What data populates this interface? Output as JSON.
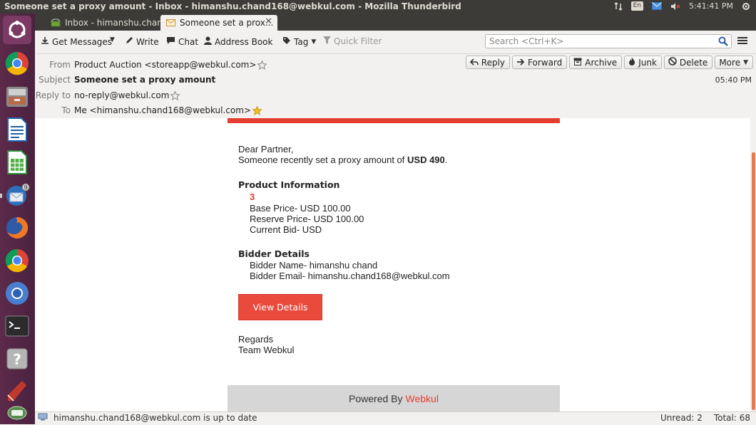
{
  "system_bar": {
    "window_title": "Someone set a proxy amount - Inbox - himanshu.chand168@webkul.com - Mozilla Thunderbird",
    "keyboard_layout": "En",
    "clock": "5:41:41 PM"
  },
  "launcher": {
    "items": [
      "ubuntu-dash-icon",
      "chrome-icon",
      "files-icon",
      "writer-icon",
      "calc-icon",
      "thunderbird-icon",
      "firefox-icon",
      "chrome-icon",
      "chromium-icon",
      "terminal-icon",
      "help-icon",
      "pencil-icon",
      "trash-icon"
    ],
    "thunderbird_badge": "9"
  },
  "tabs": [
    {
      "label": "Inbox - himanshu.chan...",
      "active": false
    },
    {
      "label": "Someone set a prox...",
      "active": true
    }
  ],
  "toolbar": {
    "get_messages": "Get Messages",
    "write": "Write",
    "chat": "Chat",
    "address_book": "Address Book",
    "tag": "Tag",
    "quick_filter": "Quick Filter",
    "search_placeholder": "Search <Ctrl+K>"
  },
  "header": {
    "from_label": "From",
    "from_value": "Product Auction <storeapp@webkul.com>",
    "subject_label": "Subject",
    "subject_value": "Someone set a proxy amount",
    "reply_to_label": "Reply to",
    "reply_to_value": "no-reply@webkul.com",
    "to_label": "To",
    "to_value": "Me <himanshu.chand168@webkul.com>",
    "time": "05:40 PM",
    "buttons": {
      "reply": "Reply",
      "forward": "Forward",
      "archive": "Archive",
      "junk": "Junk",
      "delete": "Delete",
      "more": "More"
    }
  },
  "email": {
    "greeting": "Dear Partner,",
    "intro_prefix": "Someone recently set a proxy amount of ",
    "intro_amount": "USD 490",
    "intro_suffix": ".",
    "product_heading": "Product Information",
    "product_name": "3",
    "base_price": "Base Price- USD 100.00",
    "reserve_price": "Reserve Price- USD 100.00",
    "current_bid": "Current Bid- USD",
    "bidder_heading": "Bidder Details",
    "bidder_name": "Bidder Name- himanshu chand",
    "bidder_email": "Bidder Email- himanshu.chand168@webkul.com",
    "view_button": "View Details",
    "regards": "Regards",
    "team": "Team Webkul",
    "powered_by": "Powered By",
    "brand": "Webkul"
  },
  "status_bar": {
    "message": "himanshu.chand168@webkul.com is up to date",
    "unread": "Unread: 2",
    "total": "Total: 68"
  },
  "colors": {
    "accent_red": "#e53e30",
    "system_bar": "#3c3b37",
    "launcher": "#5d2a4a"
  }
}
